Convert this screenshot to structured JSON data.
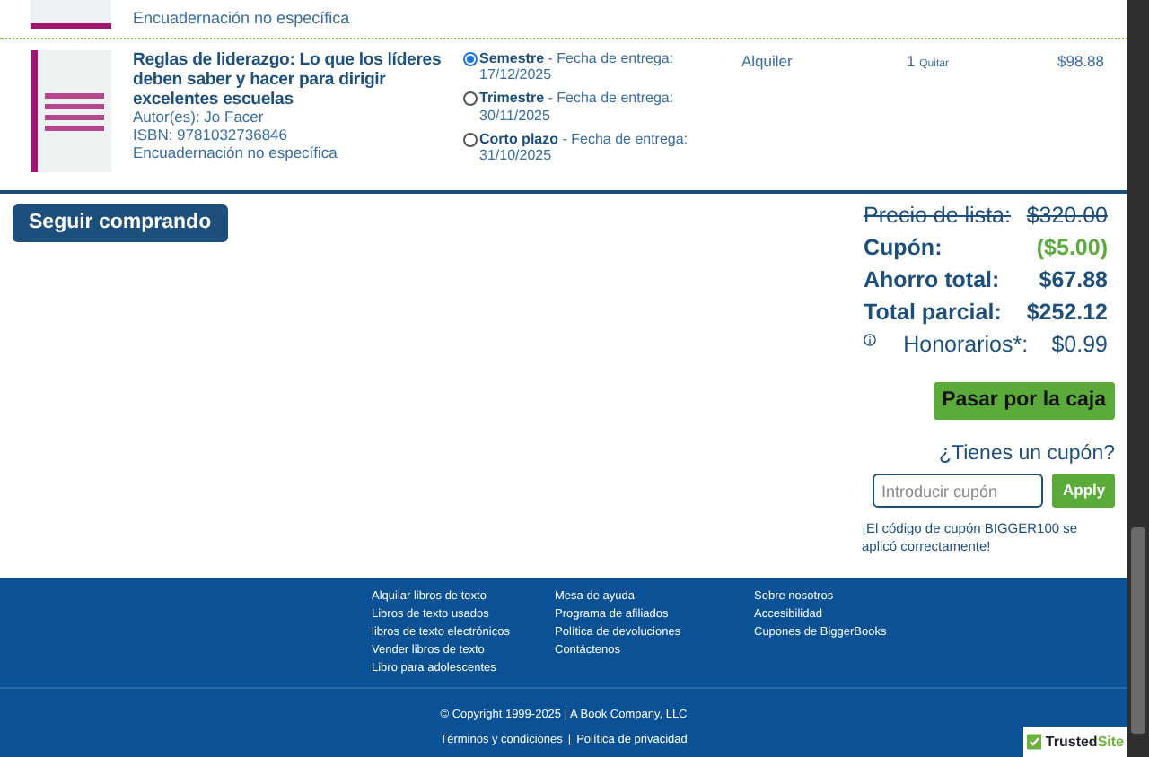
{
  "previous_item": {
    "binding": "Encuadernación no específica"
  },
  "cart_items": [
    {
      "title": "Reglas de liderazgo: Lo que los líderes deben saber y hacer para dirigir excelentes escuelas",
      "author": "Autor(es): Jo Facer",
      "isbn": "ISBN: 9781032736846",
      "binding": "Encuadernación no específica",
      "type": "Alquiler",
      "quantity": "1",
      "remove": "Quitar",
      "price": "$98.88",
      "rental_options": [
        {
          "label": "Semestre",
          "suffix": " - Fecha de entrega:",
          "date": "17/12/2025",
          "selected": true
        },
        {
          "label": "Trimestre",
          "suffix": " - Fecha de entrega:",
          "date": "30/11/2025",
          "selected": false
        },
        {
          "label": "Corto plazo",
          "suffix": " - Fecha de entrega:",
          "date": "31/10/2025",
          "selected": false
        }
      ]
    }
  ],
  "continue_button": "Seguir comprando",
  "summary": [
    {
      "kind": "strike",
      "label": "Precio de lista:",
      "value": "$320.00"
    },
    {
      "kind": "discount",
      "label": "Cupón:",
      "value": "($5.00)"
    },
    {
      "kind": "strong",
      "label": "Ahorro total:",
      "value": "$67.88"
    },
    {
      "kind": "strong",
      "label": "Total parcial:",
      "value": "$252.12"
    },
    {
      "kind": "fee",
      "label": "Honorarios*:",
      "value": "$0.99"
    }
  ],
  "checkout_button": "Pasar por la caja",
  "coupon": {
    "heading": "¿Tienes un cupón?",
    "placeholder": "Introducir cupón",
    "apply": "Apply",
    "message": "¡El código de cupón BIGGER100 se aplicó correctamente!"
  },
  "footer": {
    "columns": [
      [
        "Alquilar libros de texto",
        "Libros de texto usados",
        "libros de texto electrónicos",
        "Vender libros de texto",
        "Libro para adolescentes"
      ],
      [
        "Mesa de ayuda",
        "Programa de afiliados",
        "Política de devoluciones",
        "Contáctenos"
      ],
      [
        "Sobre nosotros",
        "Accesibilidad",
        "Cupones de BiggerBooks"
      ]
    ],
    "copyright": "© Copyright 1999-2025 | A Book Company, LLC",
    "legal_links": [
      "Términos y condiciones",
      "Política de privacidad"
    ],
    "separator": "|"
  },
  "trust_badge": {
    "text": "Trusted",
    "accent": "Site"
  }
}
